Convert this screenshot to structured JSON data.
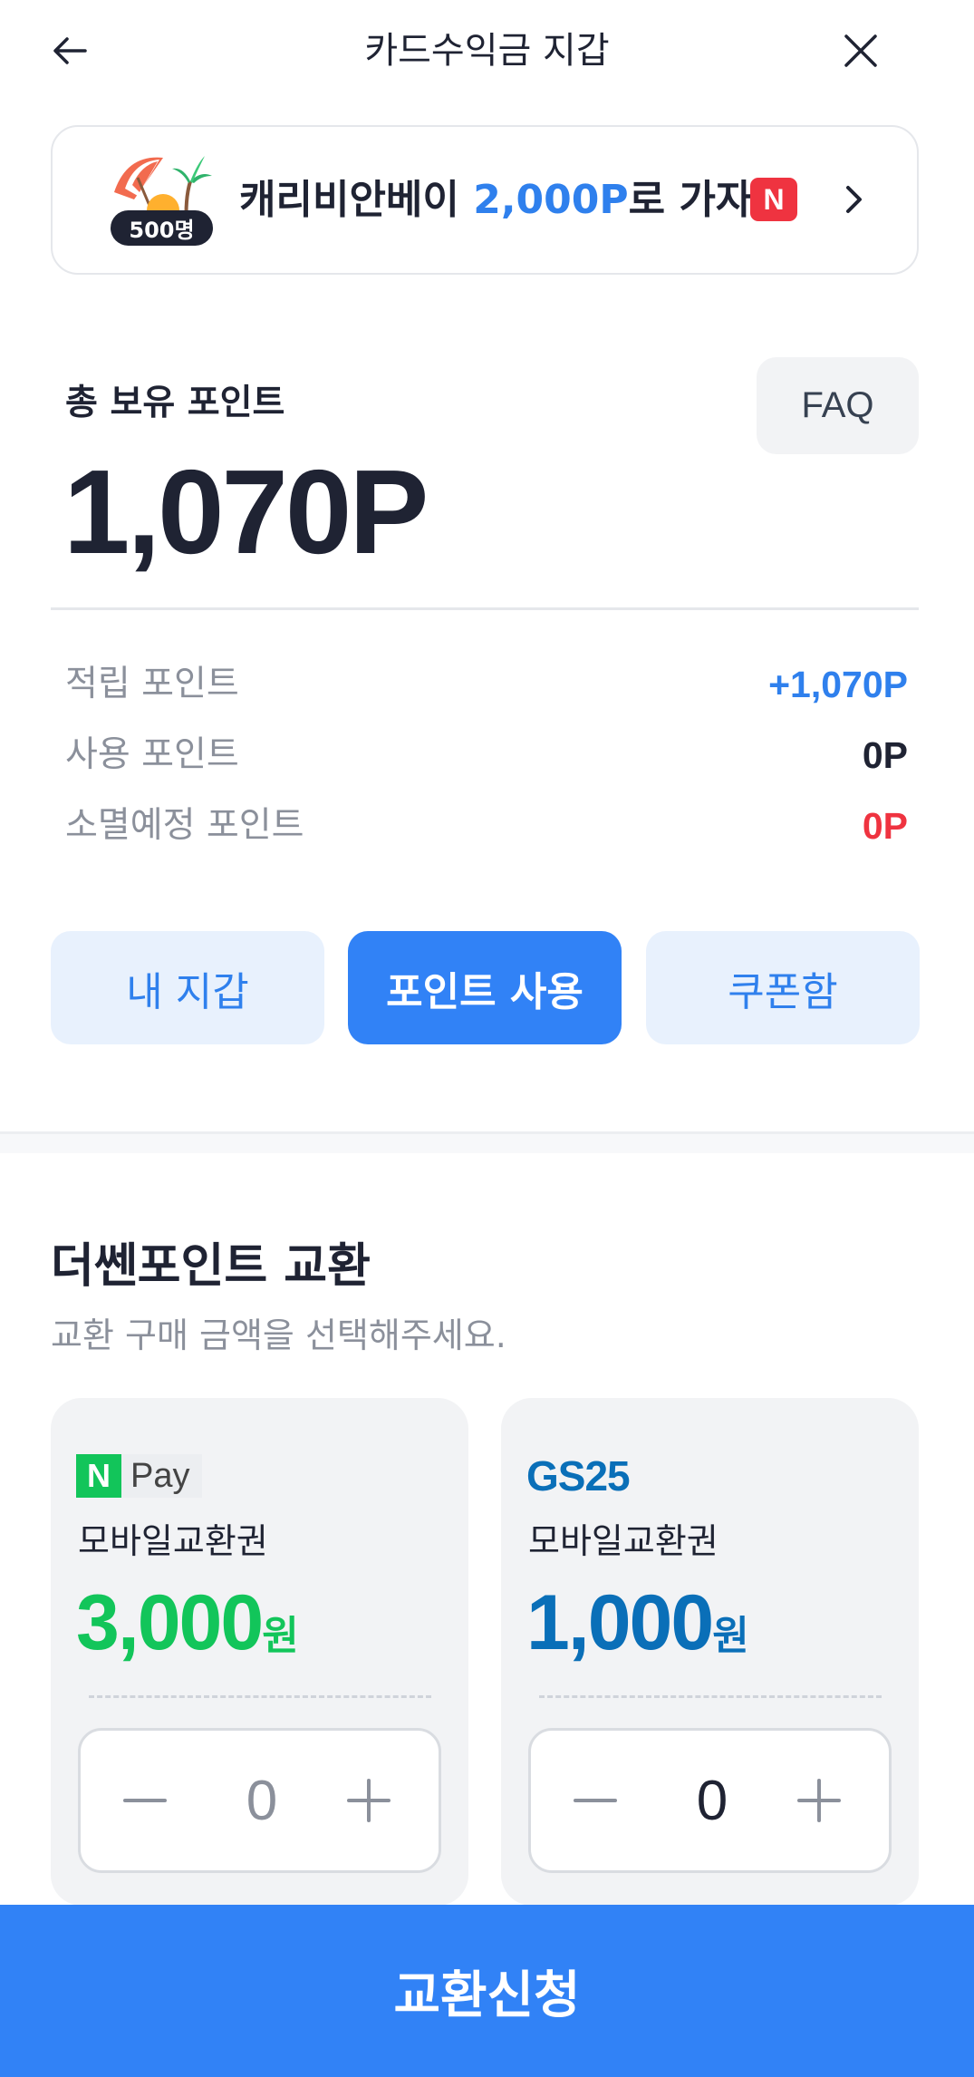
{
  "header": {
    "title": "카드수익금 지갑",
    "back_icon": "arrow-left-icon",
    "close_icon": "close-icon"
  },
  "banner": {
    "badge": "500명",
    "text_before": "캐리비안베이 ",
    "text_highlight": "2,000P",
    "text_after": "로 가자!",
    "n_badge": "N",
    "highlight_color": "#2f80ed"
  },
  "points": {
    "total_label": "총 보유 포인트",
    "total_value": "1,070P",
    "faq_label": "FAQ",
    "rows": [
      {
        "label": "적립 포인트",
        "value": "+1,070P",
        "color": "#2f80ed"
      },
      {
        "label": "사용 포인트",
        "value": "0P",
        "color": "#1f2333"
      },
      {
        "label": "소멸예정 포인트",
        "value": "0P",
        "color": "#ef3340"
      }
    ]
  },
  "actions": {
    "wallet": "내 지갑",
    "use_points": "포인트 사용",
    "coupon_box": "쿠폰함"
  },
  "exchange": {
    "title": "더쎈포인트 교환",
    "subtitle": "교환 구매 금액을 선택해주세요.",
    "cards": [
      {
        "brand_n": "N",
        "brand_text": "Pay",
        "name": "모바일교환권",
        "amount": "3,000",
        "unit": "원",
        "qty": "0",
        "color": "#12c55a"
      },
      {
        "brand_text": "GS25",
        "name": "모바일교환권",
        "amount": "1,000",
        "unit": "원",
        "qty": "0",
        "color": "#0a6fb8"
      }
    ]
  },
  "cta": {
    "label": "교환신청"
  }
}
